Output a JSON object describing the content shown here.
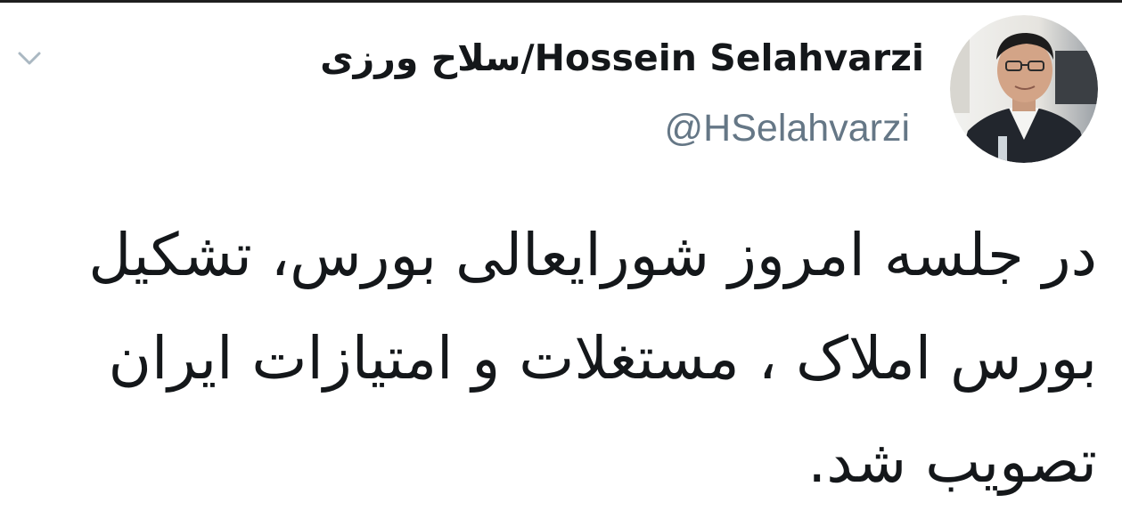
{
  "tweet": {
    "author": {
      "display_name": "سلاح ورزی/Hossein Selahvarzi",
      "handle": "@HSelahvarzi"
    },
    "text_lines": [
      "در جلسه امروز  شورایعالی بورس، تشکیل",
      "بورس املاک ، مستغلات و امتیازات ایران",
      "تصویب شد."
    ]
  },
  "icons": {
    "menu": "chevron-down-icon",
    "avatar": "avatar"
  },
  "colors": {
    "text": "#14171a",
    "handle": "#657786",
    "chevron": "#aab8c2",
    "background": "#ffffff"
  }
}
